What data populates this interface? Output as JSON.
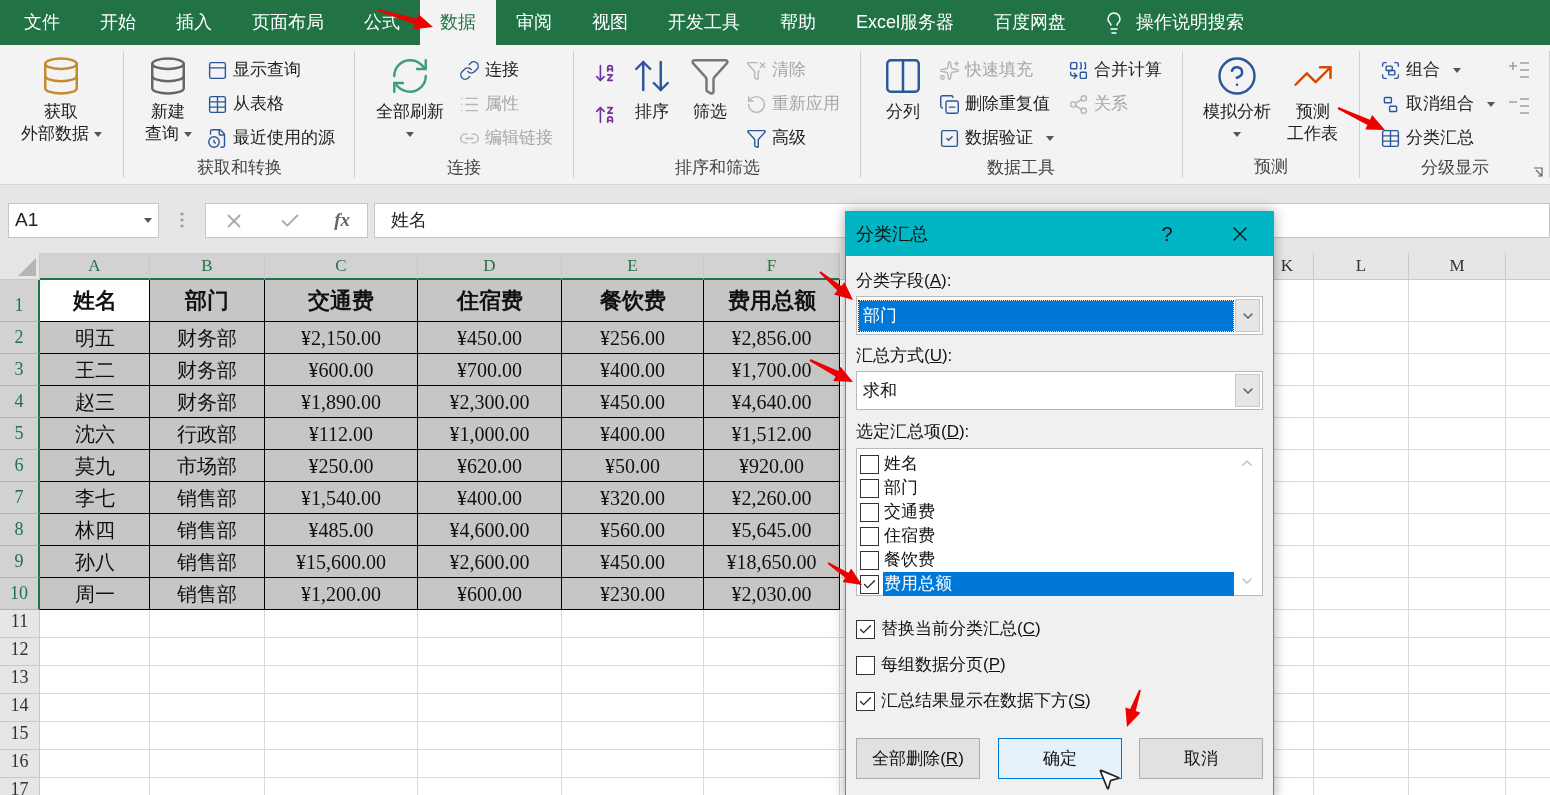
{
  "menu_tabs": [
    {
      "label": "文件",
      "selected": false
    },
    {
      "label": "开始",
      "selected": false
    },
    {
      "label": "插入",
      "selected": false
    },
    {
      "label": "页面布局",
      "selected": false
    },
    {
      "label": "公式",
      "selected": false
    },
    {
      "label": "数据",
      "selected": true
    },
    {
      "label": "审阅",
      "selected": false
    },
    {
      "label": "视图",
      "selected": false
    },
    {
      "label": "开发工具",
      "selected": false
    },
    {
      "label": "帮助",
      "selected": false
    },
    {
      "label": "Excel服务器",
      "selected": false
    },
    {
      "label": "百度网盘",
      "selected": false
    }
  ],
  "tell_me": "操作说明搜索",
  "ribbon_groups": [
    {
      "columns": [
        {
          "kind": "large",
          "lines": [
            "获取",
            "外部数据"
          ],
          "dropdown": true,
          "caret_below": false,
          "disabled": false
        }
      ]
    },
    {
      "label": "获取和转换",
      "columns": [
        {
          "kind": "large",
          "lines": [
            "新建",
            "查询"
          ],
          "dropdown": true,
          "caret_below": false,
          "disabled": false
        },
        {
          "kind": "stack",
          "items": [
            {
              "label": "显示查询",
              "disabled": false,
              "dropdown": false
            },
            {
              "label": "从表格",
              "disabled": false,
              "dropdown": false
            },
            {
              "label": "最近使用的源",
              "disabled": false,
              "dropdown": false
            }
          ]
        }
      ]
    },
    {
      "label": "连接",
      "columns": [
        {
          "kind": "large",
          "lines": [
            "全部刷新"
          ],
          "dropdown": true,
          "caret_below": true,
          "disabled": false
        },
        {
          "kind": "stack",
          "items": [
            {
              "label": "连接",
              "disabled": false,
              "dropdown": false
            },
            {
              "label": "属性",
              "disabled": true,
              "dropdown": false
            },
            {
              "label": "编辑链接",
              "disabled": true,
              "dropdown": false
            }
          ]
        }
      ]
    },
    {
      "label": "排序和筛选",
      "columns": [
        {
          "kind": "icons",
          "items": [
            {
              "disabled": false
            },
            {
              "disabled": false
            }
          ]
        },
        {
          "kind": "large",
          "lines": [
            "排序"
          ],
          "dropdown": false,
          "disabled": false
        },
        {
          "kind": "large",
          "lines": [
            "筛选"
          ],
          "dropdown": false,
          "disabled": false
        },
        {
          "kind": "stack",
          "items": [
            {
              "label": "清除",
              "disabled": true,
              "dropdown": false
            },
            {
              "label": "重新应用",
              "disabled": true,
              "dropdown": false
            },
            {
              "label": "高级",
              "disabled": false,
              "dropdown": false
            }
          ]
        }
      ]
    },
    {
      "label": "数据工具",
      "columns": [
        {
          "kind": "large",
          "lines": [
            "分列"
          ],
          "dropdown": false,
          "disabled": false
        },
        {
          "kind": "stack",
          "items": [
            {
              "label": "快速填充",
              "disabled": true,
              "dropdown": false
            },
            {
              "label": "删除重复值",
              "disabled": false,
              "dropdown": false
            },
            {
              "label": "数据验证",
              "disabled": false,
              "dropdown": true
            }
          ]
        },
        {
          "kind": "stack",
          "items": [
            {
              "label": "合并计算",
              "disabled": false,
              "dropdown": false
            },
            {
              "label": "关系",
              "disabled": true,
              "dropdown": false
            }
          ]
        }
      ]
    },
    {
      "label": "预测",
      "columns": [
        {
          "kind": "large",
          "lines": [
            "模拟分析"
          ],
          "dropdown": true,
          "caret_below": true,
          "disabled": false
        },
        {
          "kind": "large",
          "lines": [
            "预测",
            "工作表"
          ],
          "dropdown": false,
          "disabled": false
        }
      ]
    },
    {
      "label": "分级显示",
      "launcher": true,
      "columns": [
        {
          "kind": "stack",
          "items": [
            {
              "label": "组合",
              "disabled": false,
              "dropdown": true
            },
            {
              "label": "取消组合",
              "disabled": false,
              "dropdown": true
            },
            {
              "label": "分类汇总",
              "disabled": false,
              "dropdown": false
            }
          ]
        },
        {
          "kind": "icons",
          "items": [
            {
              "disabled": true
            },
            {
              "disabled": true
            }
          ]
        }
      ]
    }
  ],
  "sheet": {
    "name_box": "A1",
    "function_label": "fx",
    "formula": "姓名",
    "columns": [
      {
        "label": "A",
        "kind": "table",
        "selected": true
      },
      {
        "label": "B",
        "kind": "table",
        "selected": true
      },
      {
        "label": "C",
        "kind": "table",
        "selected": true
      },
      {
        "label": "D",
        "kind": "table",
        "selected": true
      },
      {
        "label": "E",
        "kind": "table",
        "selected": true
      },
      {
        "label": "F",
        "kind": "table",
        "selected": true
      },
      {
        "label": "K",
        "kind": "free",
        "selected": false
      },
      {
        "label": "L",
        "kind": "free",
        "selected": false
      },
      {
        "label": "M",
        "kind": "free",
        "selected": false
      }
    ],
    "rows": [
      {
        "number": "1",
        "kind": "header",
        "selected": true,
        "active": true,
        "cells": [
          "姓名",
          "部门",
          "交通费",
          "住宿费",
          "餐饮费",
          "费用总额"
        ]
      },
      {
        "number": "2",
        "kind": "data",
        "selected": true,
        "active": false,
        "cells": [
          "明五",
          "财务部",
          "¥2,150.00",
          "¥450.00",
          "¥256.00",
          "¥2,856.00"
        ]
      },
      {
        "number": "3",
        "kind": "data",
        "selected": true,
        "active": false,
        "cells": [
          "王二",
          "财务部",
          "¥600.00",
          "¥700.00",
          "¥400.00",
          "¥1,700.00"
        ]
      },
      {
        "number": "4",
        "kind": "data",
        "selected": true,
        "active": false,
        "cells": [
          "赵三",
          "财务部",
          "¥1,890.00",
          "¥2,300.00",
          "¥450.00",
          "¥4,640.00"
        ]
      },
      {
        "number": "5",
        "kind": "data",
        "selected": true,
        "active": false,
        "cells": [
          "沈六",
          "行政部",
          "¥112.00",
          "¥1,000.00",
          "¥400.00",
          "¥1,512.00"
        ]
      },
      {
        "number": "6",
        "kind": "data",
        "selected": true,
        "active": false,
        "cells": [
          "莫九",
          "市场部",
          "¥250.00",
          "¥620.00",
          "¥50.00",
          "¥920.00"
        ]
      },
      {
        "number": "7",
        "kind": "data",
        "selected": true,
        "active": false,
        "cells": [
          "李七",
          "销售部",
          "¥1,540.00",
          "¥400.00",
          "¥320.00",
          "¥2,260.00"
        ]
      },
      {
        "number": "8",
        "kind": "data",
        "selected": true,
        "active": false,
        "cells": [
          "林四",
          "销售部",
          "¥485.00",
          "¥4,600.00",
          "¥560.00",
          "¥5,645.00"
        ]
      },
      {
        "number": "9",
        "kind": "data",
        "selected": true,
        "active": false,
        "cells": [
          "孙八",
          "销售部",
          "¥15,600.00",
          "¥2,600.00",
          "¥450.00",
          "¥18,650.00"
        ]
      },
      {
        "number": "10",
        "kind": "data",
        "selected": true,
        "active": false,
        "cells": [
          "周一",
          "销售部",
          "¥1,200.00",
          "¥600.00",
          "¥230.00",
          "¥2,030.00"
        ]
      },
      {
        "number": "11",
        "kind": "empty",
        "selected": false,
        "active": false
      },
      {
        "number": "12",
        "kind": "empty",
        "selected": false,
        "active": false
      },
      {
        "number": "13",
        "kind": "empty",
        "selected": false,
        "active": false
      },
      {
        "number": "14",
        "kind": "empty",
        "selected": false,
        "active": false
      },
      {
        "number": "15",
        "kind": "empty",
        "selected": false,
        "active": false
      },
      {
        "number": "16",
        "kind": "empty",
        "selected": false,
        "active": false
      },
      {
        "number": "17",
        "kind": "empty",
        "selected": false,
        "active": false
      }
    ]
  },
  "dialog": {
    "title": "分类汇总",
    "help": "?",
    "selects": [
      {
        "label": "分类字段(A):",
        "value": "部门",
        "focused": true
      },
      {
        "label": "汇总方式(U):",
        "value": "求和",
        "focused": false
      }
    ],
    "items_label": "选定汇总项(D):",
    "items": [
      {
        "label": "姓名",
        "checked": false,
        "selected": false
      },
      {
        "label": "部门",
        "checked": false,
        "selected": false
      },
      {
        "label": "交通费",
        "checked": false,
        "selected": false
      },
      {
        "label": "住宿费",
        "checked": false,
        "selected": false
      },
      {
        "label": "餐饮费",
        "checked": false,
        "selected": false
      },
      {
        "label": "费用总额",
        "checked": true,
        "selected": true
      }
    ],
    "options": [
      {
        "label": "替换当前分类汇总(C)",
        "checked": true
      },
      {
        "label": "每组数据分页(P)",
        "checked": false
      },
      {
        "label": "汇总结果显示在数据下方(S)",
        "checked": true
      }
    ],
    "buttons": [
      {
        "label": "全部删除(R)",
        "selected": false
      },
      {
        "label": "确定",
        "selected": true
      },
      {
        "label": "取消",
        "selected": false
      }
    ]
  }
}
